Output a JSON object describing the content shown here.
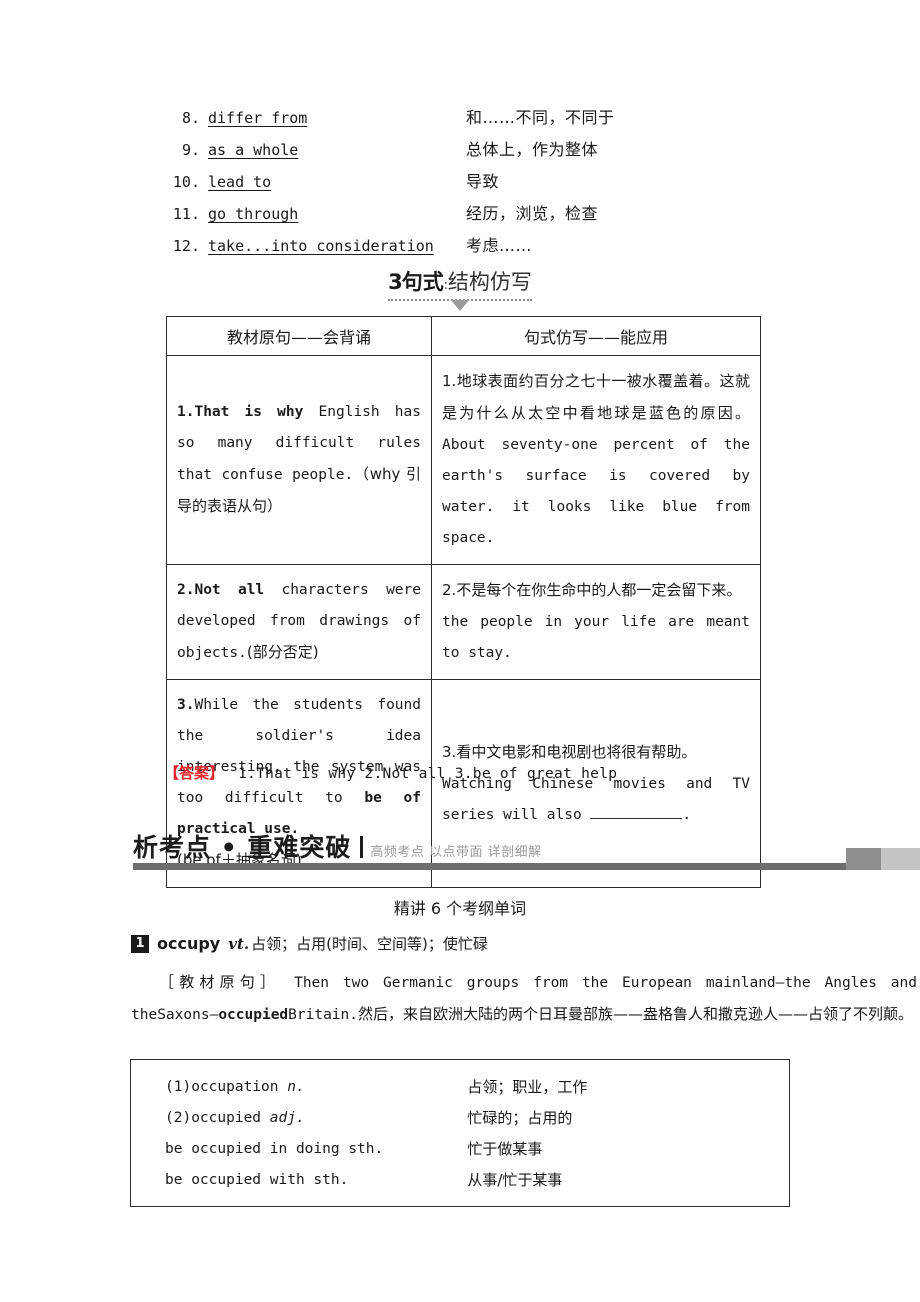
{
  "phrases": [
    {
      "num": "8.",
      "en": "differ from",
      "cn": "和……不同，不同于"
    },
    {
      "num": "9.",
      "en": "as a whole",
      "cn": "总体上，作为整体"
    },
    {
      "num": "10.",
      "en": "lead to",
      "cn": "导致"
    },
    {
      "num": "11.",
      "en": "go through",
      "cn": "经历，浏览，检查"
    },
    {
      "num": "12.",
      "en": "take...into consideration",
      "cn": "考虑……"
    }
  ],
  "section_heading": {
    "number": "3",
    "title": "句式",
    "colon": ":",
    "subtitle": "结构仿写"
  },
  "table1": {
    "headers": [
      "教材原句——会背诵",
      "句式仿写——能应用"
    ],
    "rows": [
      {
        "left_num": "1.",
        "left_bold": "That is why",
        "left_rest": " English has so many difficult rules that confuse people.",
        "left_note": "（why 引导的表语从句）",
        "right_num": "1.",
        "right_cn": "地球表面约百分之七十一被水覆盖着。这就是为什么从太空中看地球是蓝色的原因。",
        "right_en": "About seventy-one percent of the earth's surface is covered by water. it looks like blue from space."
      },
      {
        "left_num": "2.",
        "left_bold": "Not all",
        "left_rest": "  characters were developed from drawings of objects.",
        "left_note": "(部分否定)",
        "right_num": "2.",
        "right_cn": "不是每个在你生命中的人都一定会留下来。",
        "right_en": "the people in your life are meant to stay."
      },
      {
        "left_num": "3.",
        "left_pre": "While the students found the soldier's idea interesting, the system was too difficult to ",
        "left_bold": "be of practical use.",
        "left_note": "(be of＋抽象名词)",
        "right_num": "3.",
        "right_cn": "看中文电影和电视剧也将很有帮助。",
        "right_en_pre": "Watching Chinese movies and TV series will also ",
        "right_en_post": "."
      }
    ]
  },
  "answer": {
    "label": "【答案】",
    "text": "1.That is why  2.Not all  3.be of great help"
  },
  "banner": {
    "title": "析考点 • 重难突破",
    "subtitle": "高频考点 以点带面 详剖细解"
  },
  "unit_title": "精讲 6 个考纲单词",
  "entry": {
    "badge": "1",
    "word": "occupy",
    "pos": "vt.",
    "definition": "占领；占用(时间、空间等)；使忙碌",
    "source_label": "［教材原句］",
    "source_en_1": "Then two Germanic groups from the European mainland—the Angles and theSaxons—",
    "source_bold": "occupied",
    "source_en_2": "Britain.",
    "source_cn": "然后，来自欧洲大陆的两个日耳曼部族——盎格鲁人和撒克逊人——占领了不列颠。"
  },
  "table2": {
    "rows": [
      {
        "marker": "(1)",
        "en": "occupation ",
        "italic": "n.",
        "cn": "占领；职业，工作",
        "indent": false
      },
      {
        "marker": "(2)",
        "en": "occupied ",
        "italic": "adj.",
        "cn": "忙碌的；占用的",
        "indent": false
      },
      {
        "marker": "",
        "en": "be occupied in doing sth.",
        "italic": "",
        "cn": "忙于做某事",
        "indent": true
      },
      {
        "marker": "",
        "en": "be occupied with sth.",
        "italic": "",
        "cn": "从事/忙于某事",
        "indent": true
      }
    ]
  },
  "colors": {
    "answer_red": "#e3262c",
    "banner_rule": "#6e6e6e",
    "banner_sub_gray": "#9b9b9b"
  }
}
